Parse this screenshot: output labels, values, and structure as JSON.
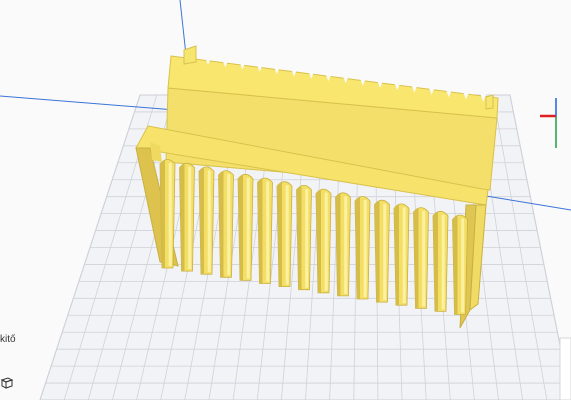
{
  "app": {
    "sidebar_partial_label": "kitő"
  },
  "scene": {
    "model_color": "#f5e36a",
    "model_shade_color": "#d9c24c",
    "grid_color": "#c9ccd3",
    "plate_color": "#f2f3f6",
    "axis_x_color": "#e02020",
    "axis_y_color": "#2060e0",
    "axis_z_color": "#20a040",
    "icons": [
      "view-cube-icon",
      "axis-gizmo-icon"
    ]
  }
}
